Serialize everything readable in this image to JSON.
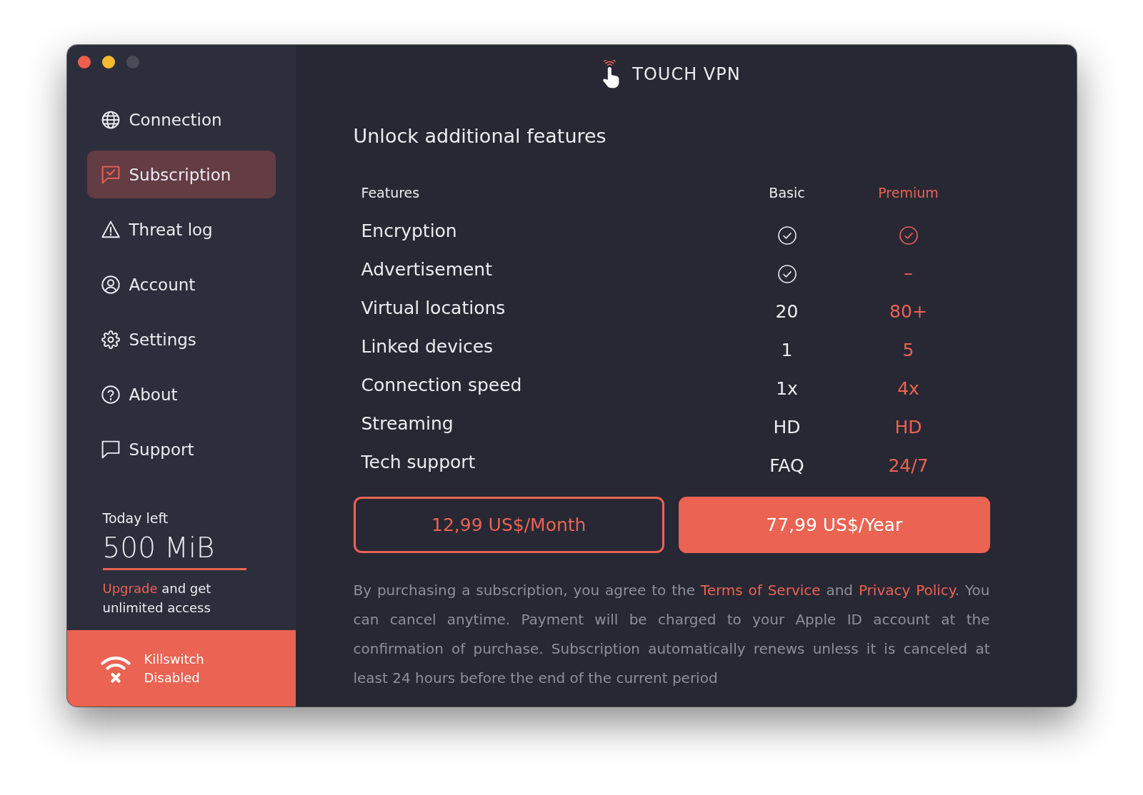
{
  "window": {
    "controls": [
      {
        "kind": "close",
        "disabled": false
      },
      {
        "kind": "minimize",
        "disabled": false
      },
      {
        "kind": "zoom",
        "disabled": true
      }
    ]
  },
  "app_title": "TOUCH VPN",
  "nav": [
    {
      "label": "Connection",
      "selected": false
    },
    {
      "label": "Subscription",
      "selected": true
    },
    {
      "label": "Threat log",
      "selected": false
    },
    {
      "label": "Account",
      "selected": false
    },
    {
      "label": "Settings",
      "selected": false
    },
    {
      "label": "About",
      "selected": false
    },
    {
      "label": "Support",
      "selected": false
    }
  ],
  "usage": {
    "label": "Today left",
    "value": "500 MiB",
    "note": [
      {
        "kind": "link",
        "text": "Upgrade"
      },
      {
        "kind": "text",
        "text": " and get unlimited access"
      }
    ]
  },
  "killswitch": {
    "label": "Killswitch",
    "status": "Disabled",
    "enabled": false
  },
  "heading": "Unlock additional features",
  "table": {
    "columns": [
      {
        "label": "Features",
        "highlighted": false
      },
      {
        "label": "Basic",
        "highlighted": false
      },
      {
        "label": "Premium",
        "highlighted": true
      }
    ],
    "rows": [
      {
        "cells": [
          {
            "kind": "text",
            "text": "Encryption"
          },
          {
            "kind": "check"
          },
          {
            "kind": "check"
          }
        ]
      },
      {
        "cells": [
          {
            "kind": "text",
            "text": "Advertisement"
          },
          {
            "kind": "check"
          },
          {
            "kind": "text",
            "text": "–"
          }
        ]
      },
      {
        "cells": [
          {
            "kind": "text",
            "text": "Virtual locations"
          },
          {
            "kind": "text",
            "text": "20"
          },
          {
            "kind": "text",
            "text": "80+"
          }
        ]
      },
      {
        "cells": [
          {
            "kind": "text",
            "text": "Linked devices"
          },
          {
            "kind": "text",
            "text": "1"
          },
          {
            "kind": "text",
            "text": "5"
          }
        ]
      },
      {
        "cells": [
          {
            "kind": "text",
            "text": "Connection speed"
          },
          {
            "kind": "text",
            "text": "1x"
          },
          {
            "kind": "text",
            "text": "4x"
          }
        ]
      },
      {
        "cells": [
          {
            "kind": "text",
            "text": "Streaming"
          },
          {
            "kind": "text",
            "text": "HD"
          },
          {
            "kind": "text",
            "text": "HD"
          }
        ]
      },
      {
        "cells": [
          {
            "kind": "text",
            "text": "Tech support"
          },
          {
            "kind": "text",
            "text": "FAQ"
          },
          {
            "kind": "text",
            "text": "24/7"
          }
        ]
      }
    ]
  },
  "plans": [
    {
      "label": "12,99 US$/Month",
      "primary": false
    },
    {
      "label": "77,99 US$/Year",
      "primary": true
    }
  ],
  "terms": [
    {
      "kind": "text",
      "text": "By purchasing a subscription, you agree to the "
    },
    {
      "kind": "link",
      "text": "Terms of Service"
    },
    {
      "kind": "text",
      "text": " and "
    },
    {
      "kind": "link",
      "text": "Privacy Policy"
    },
    {
      "kind": "text",
      "text": ". You can cancel anytime. Payment will be charged to your Apple ID account at the confirmation of purchase. Subscription automatically renews unless it is canceled at least 24 hours before the end of the current period"
    }
  ]
}
